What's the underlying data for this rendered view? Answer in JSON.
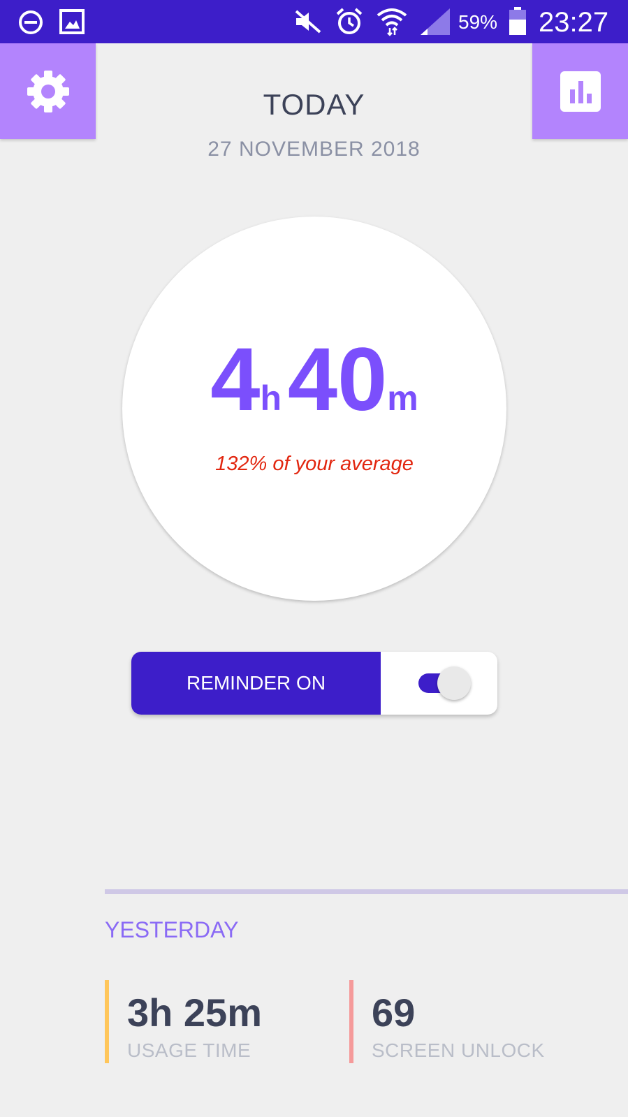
{
  "status_bar": {
    "icons": [
      "do-not-disturb-icon",
      "image-icon",
      "mute-icon",
      "alarm-icon",
      "wifi-icon",
      "signal-icon",
      "battery-icon"
    ],
    "battery": "59%",
    "time": "23:27"
  },
  "header": {
    "title": "TODAY",
    "date": "27 NOVEMBER 2018",
    "left_icon": "settings-icon",
    "right_icon": "stats-icon"
  },
  "usage": {
    "hours": "4",
    "hours_unit": "h",
    "minutes": "40",
    "minutes_unit": "m",
    "average_text": "132% of your average"
  },
  "reminder": {
    "label": "REMINDER ON",
    "enabled": true
  },
  "yesterday": {
    "title": "YESTERDAY",
    "stats": [
      {
        "value": "3h 25m",
        "label": "USAGE TIME",
        "color": "#ffc65a"
      },
      {
        "value": "69",
        "label": "SCREEN UNLOCK",
        "color": "#f59a9a"
      }
    ]
  },
  "colors": {
    "primary": "#3d1ec9",
    "accent": "#b384fd",
    "usage_text": "#7b4ffc",
    "warning": "#e2260f"
  }
}
